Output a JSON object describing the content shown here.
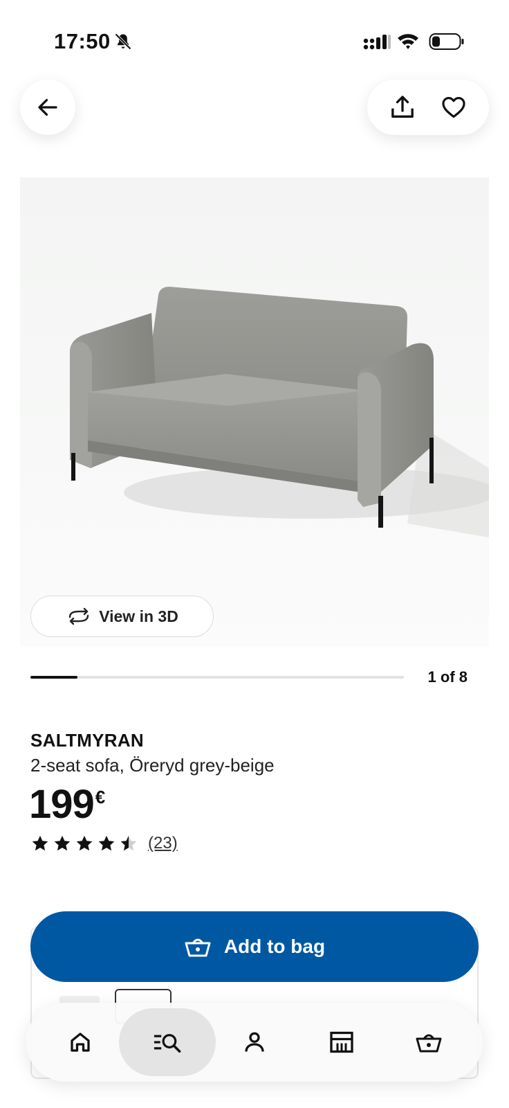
{
  "status_bar": {
    "time": "17:50",
    "icons": [
      "bell-muted-icon",
      "signal-icon",
      "wifi-icon",
      "battery-icon"
    ]
  },
  "top_bar": {
    "icons": [
      "arrow-left-icon",
      "share-icon",
      "heart-icon"
    ]
  },
  "gallery": {
    "view_3d_label": "View in 3D",
    "counter": "1 of 8",
    "current": 1,
    "total": 8,
    "progress_fraction": 0.125
  },
  "product": {
    "name": "SALTMYRAN",
    "description": "2-seat sofa, Öreryd grey-beige",
    "price": "199",
    "currency": "€",
    "rating": 4.5,
    "rating_max": 5,
    "review_count": "(23)"
  },
  "cta": {
    "add_to_bag_label": "Add to bag"
  },
  "bottom_nav": {
    "items": [
      {
        "name": "home",
        "icon": "home-icon",
        "active": false
      },
      {
        "name": "search",
        "icon": "search-list-icon",
        "active": true
      },
      {
        "name": "profile",
        "icon": "person-icon",
        "active": false
      },
      {
        "name": "stores",
        "icon": "store-icon",
        "active": false
      },
      {
        "name": "bag",
        "icon": "basket-icon",
        "active": false
      }
    ]
  },
  "colors": {
    "primary_blue": "#0058a3",
    "text": "#111111",
    "nav_active_bg": "#e4e4e4"
  }
}
